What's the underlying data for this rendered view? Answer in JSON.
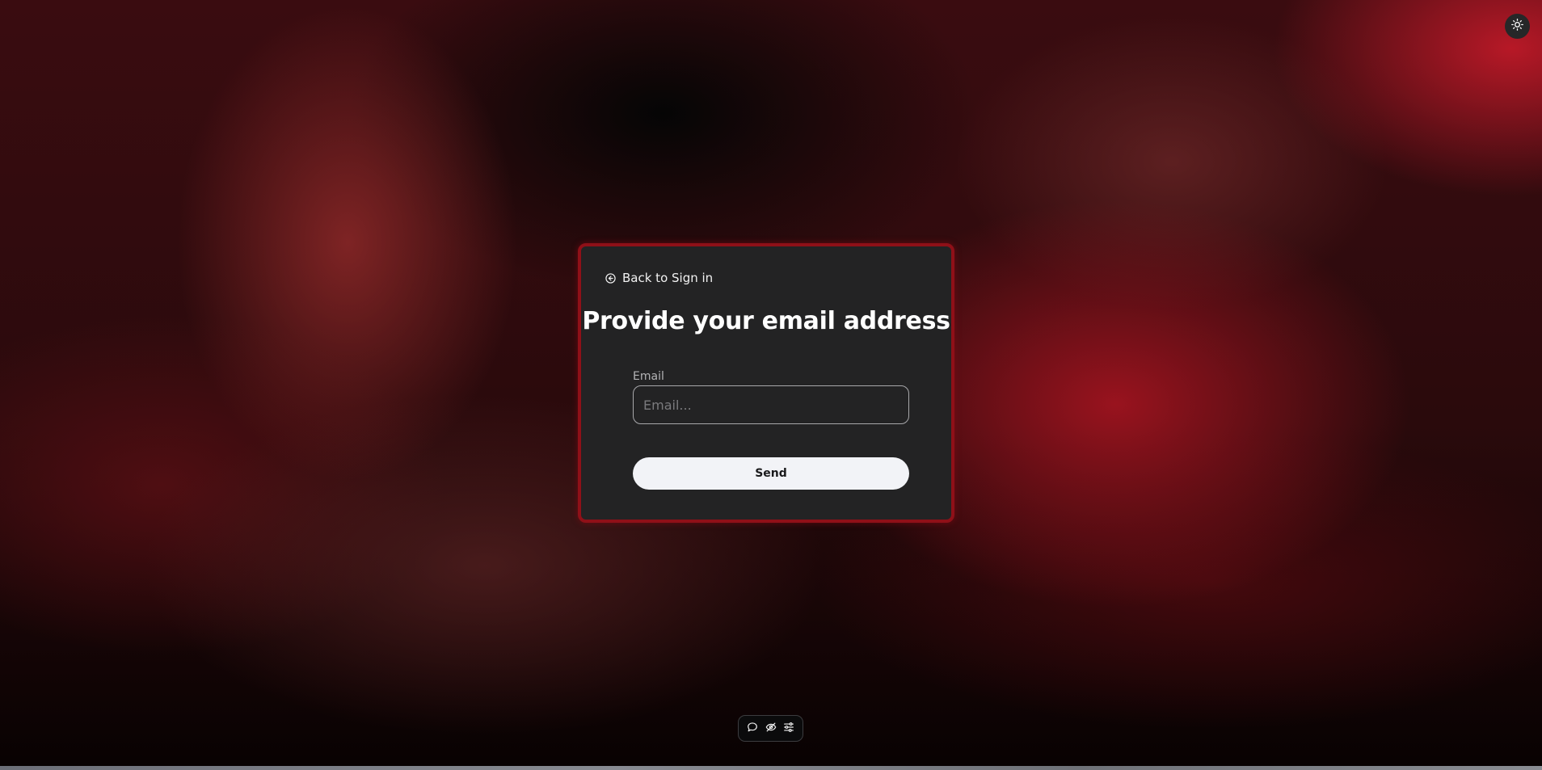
{
  "page": {
    "back_link_label": "Back to Sign in",
    "title": "Provide your email address"
  },
  "form": {
    "email_label": "Email",
    "email_placeholder": "Email...",
    "email_value": "",
    "submit_label": "Send"
  },
  "icons": {
    "theme_toggle": "sun-icon",
    "back": "circle-arrow-left-icon",
    "toolbar": [
      "speech-bubble-icon",
      "eye-slash-icon",
      "sliders-icon"
    ]
  },
  "colors": {
    "card_border": "#8f1018",
    "card_background": "#232324",
    "button_background": "#f2f3f7",
    "accent_red": "#be1928"
  }
}
